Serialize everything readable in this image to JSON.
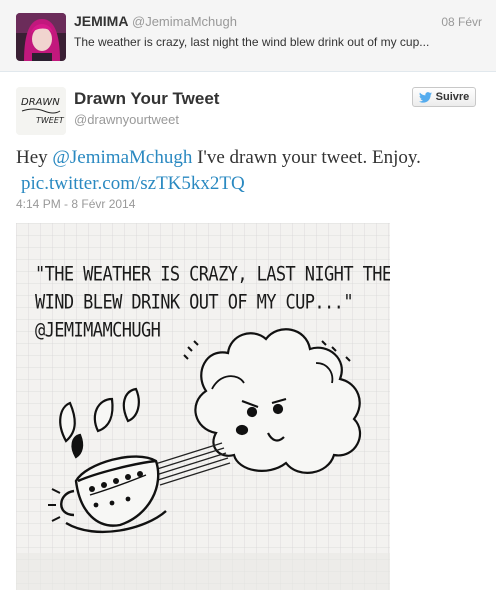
{
  "parent_tweet": {
    "name": "JEMIMA",
    "handle": "@JemimaMchugh",
    "date": "08 Févr",
    "text": "The weather is crazy, last night the wind blew drink out of my cup..."
  },
  "main_tweet": {
    "name": "Drawn Your Tweet",
    "handle": "@drawnyourtweet",
    "follow_label": "Suivre",
    "text_prefix": "Hey ",
    "mention": "@JemimaMchugh",
    "text_suffix": " I've drawn your tweet. Enjoy.",
    "link": "pic.twitter.com/szTK5kx2TQ",
    "timestamp": "4:14 PM - 8 Févr 2014"
  },
  "photo": {
    "quote_line_1": "\"THE WEATHER IS CRAZY, LAST NIGHT THE",
    "quote_line_2": "WIND BLEW DRINK OUT OF MY CUP...\"",
    "quote_line_3": "@JEMIMAMCHUGH"
  },
  "avatar_logo_text": {
    "line_1": "DRAWN",
    "line_2": "TWEET"
  },
  "colors": {
    "link": "#2a89c1",
    "follow_bird": "#55acee"
  }
}
